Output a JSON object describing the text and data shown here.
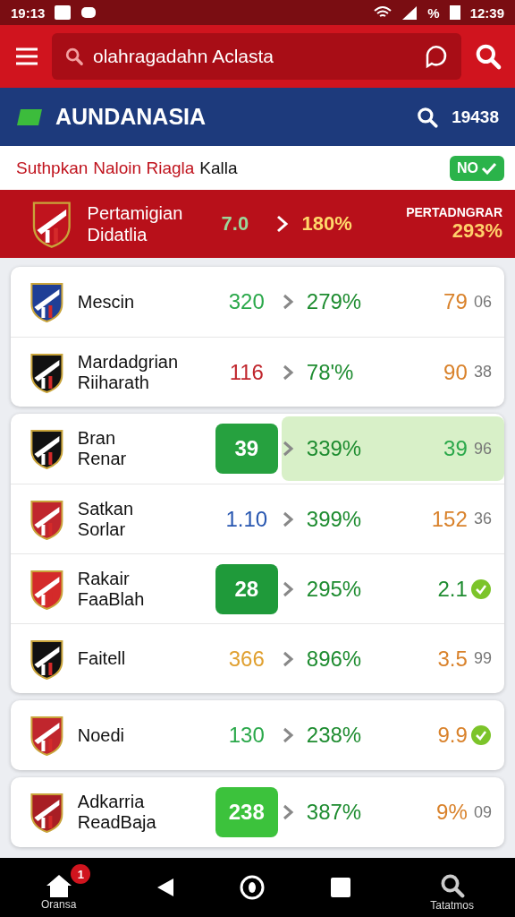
{
  "status_bar": {
    "time_left": "19:13",
    "battery_text": "%",
    "time_right": "12:39"
  },
  "search_header": {
    "placeholder": "olahragadahn Aclasta"
  },
  "title_bar": {
    "title": "AUNDANASIA",
    "count": "19438"
  },
  "filter_line": {
    "parts": [
      {
        "text": "Suthpkan",
        "highlight": true
      },
      {
        "text": "Naloin Riagla",
        "highlight": true
      },
      {
        "text": "Kalla",
        "highlight": false
      }
    ],
    "badge": "NO"
  },
  "featured": {
    "name_lines": [
      "Pertamigian",
      "Didatlia"
    ],
    "value": "7.0",
    "percent": "180%",
    "label": "PERTADNGRAR",
    "label_value": "293%"
  },
  "cards": [
    {
      "rows": [
        {
          "name_lines": [
            "Mescin"
          ],
          "crest": {
            "color": "#1f3f96"
          },
          "value": {
            "text": "320",
            "color": "#2aa84a"
          },
          "boxed": false,
          "percent": "279%",
          "stat": {
            "text": "79",
            "color": "#d9822b"
          },
          "highlighted": false,
          "checked": false,
          "extra": "06"
        },
        {
          "name_lines": [
            "Mardadgrian",
            "Riiharath"
          ],
          "crest": {
            "color": "#111111"
          },
          "value": {
            "text": "116",
            "color": "#c0262d"
          },
          "boxed": false,
          "percent": "78'%",
          "stat": {
            "text": "90",
            "color": "#d9822b"
          },
          "highlighted": false,
          "checked": false,
          "extra": "38"
        }
      ]
    },
    {
      "rows": [
        {
          "name_lines": [
            "Bran",
            "Renar"
          ],
          "crest": {
            "color": "#111111"
          },
          "value": {
            "text": "39",
            "color": "#26a13f"
          },
          "boxed": true,
          "percent": "339%",
          "stat": {
            "text": "39",
            "color": "#2aa84a"
          },
          "highlighted": true,
          "checked": false,
          "extra": "96"
        },
        {
          "name_lines": [
            "Satkan",
            "Sorlar"
          ],
          "crest": {
            "color": "#c0262d"
          },
          "value": {
            "text": "1.10",
            "color": "#2756b0"
          },
          "boxed": false,
          "percent": "399%",
          "stat": {
            "text": "152",
            "color": "#d9822b"
          },
          "highlighted": false,
          "checked": false,
          "extra": "36"
        },
        {
          "name_lines": [
            "Rakair",
            "FaaBlah"
          ],
          "crest": {
            "color": "#d42a2a"
          },
          "value": {
            "text": "28",
            "color": "#1f9a3a"
          },
          "boxed": true,
          "percent": "295%",
          "stat": {
            "text": "2.1",
            "color": "#1e8c30"
          },
          "highlighted": false,
          "checked": true
        },
        {
          "name_lines": [
            "Faitell"
          ],
          "crest": {
            "color": "#111111"
          },
          "value": {
            "text": "366",
            "color": "#e0a030"
          },
          "boxed": false,
          "percent": "896%",
          "stat": {
            "text": "3.5",
            "color": "#d9822b"
          },
          "highlighted": false,
          "checked": false,
          "extra": "99"
        }
      ]
    },
    {
      "rows": [
        {
          "name_lines": [
            "Noedi"
          ],
          "crest": {
            "color": "#c0262d"
          },
          "value": {
            "text": "130",
            "color": "#2aa84a"
          },
          "boxed": false,
          "percent": "238%",
          "stat": {
            "text": "9.9",
            "color": "#d9822b"
          },
          "highlighted": false,
          "checked": true
        }
      ]
    },
    {
      "rows": [
        {
          "name_lines": [
            "Adkarria",
            "ReadBaja"
          ],
          "crest": {
            "color": "#a81e24"
          },
          "value": {
            "text": "238",
            "color": "#3cc23c"
          },
          "boxed": true,
          "percent": "387%",
          "stat": {
            "text": "9%",
            "color": "#d9822b"
          },
          "highlighted": false,
          "checked": false,
          "extra": "09"
        }
      ]
    }
  ],
  "nav_bar": {
    "home_label": "Oransa",
    "home_badge": "1",
    "search_label": "Tatatmos"
  }
}
